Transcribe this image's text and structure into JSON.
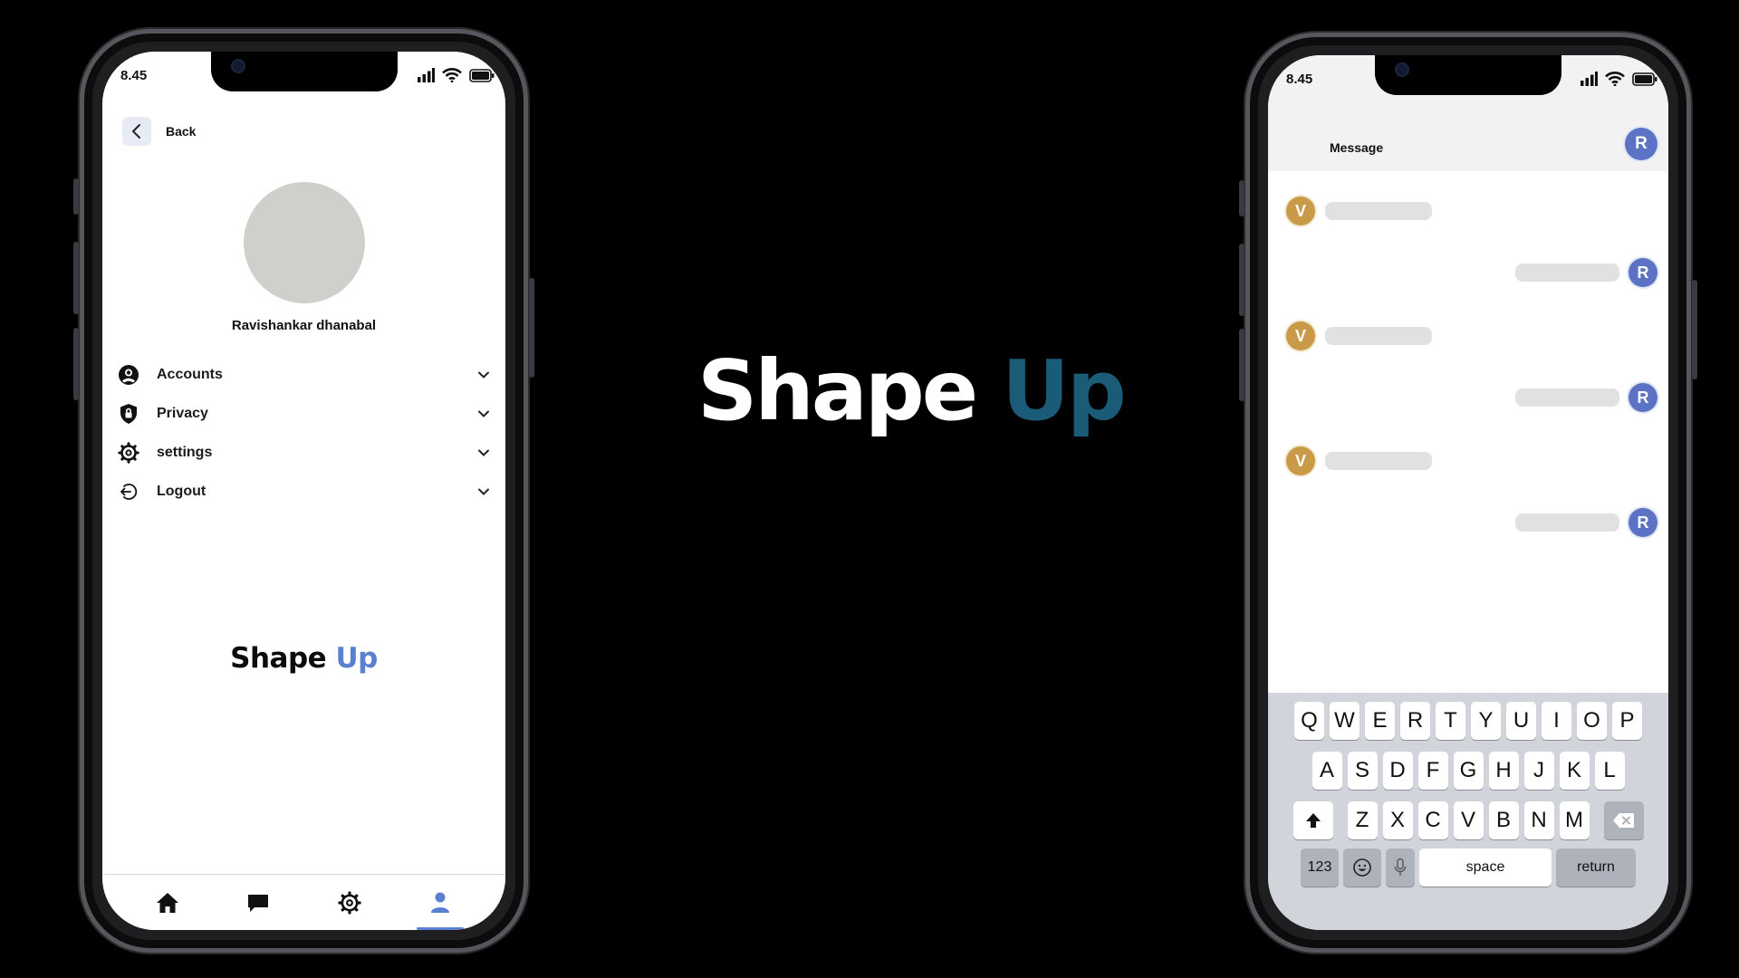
{
  "left_phone": {
    "status": {
      "time": "8.45"
    },
    "back_label": "Back",
    "profile_name": "Ravishankar dhanabal",
    "menu": [
      {
        "label": "Accounts",
        "icon": "account-circle-icon"
      },
      {
        "label": "Privacy",
        "icon": "shield-icon"
      },
      {
        "label": "settings",
        "icon": "gear-icon"
      },
      {
        "label": "Logout",
        "icon": "logout-icon"
      }
    ],
    "brand": {
      "word1": "Shape",
      "word2": "Up"
    },
    "bottom_nav": [
      "home-icon",
      "chat-icon",
      "gear-icon",
      "user-icon"
    ],
    "active_nav": "user-icon"
  },
  "center_brand": {
    "word1": "Shape",
    "word2": "Up"
  },
  "right_phone": {
    "status": {
      "time": "8.45"
    },
    "header_title": "Message",
    "header_avatar": "R",
    "messages": [
      {
        "sender": "V"
      },
      {
        "sender": "R"
      },
      {
        "sender": "V"
      },
      {
        "sender": "R"
      },
      {
        "sender": "V"
      },
      {
        "sender": "R"
      }
    ],
    "keyboard": {
      "row1": [
        "Q",
        "W",
        "E",
        "R",
        "T",
        "Y",
        "U",
        "I",
        "O",
        "P"
      ],
      "row2": [
        "A",
        "S",
        "D",
        "F",
        "G",
        "H",
        "J",
        "K",
        "L"
      ],
      "row3": [
        "Z",
        "X",
        "C",
        "V",
        "B",
        "N",
        "M"
      ],
      "numbers_key": "123",
      "space_key": "space",
      "return_key": "return"
    }
  },
  "colors": {
    "brand_blue_dark": "#1a5b78",
    "brand_blue_light": "#5b7fd1",
    "avatar_r": "#5b72c5",
    "avatar_v": "#c99a47"
  }
}
